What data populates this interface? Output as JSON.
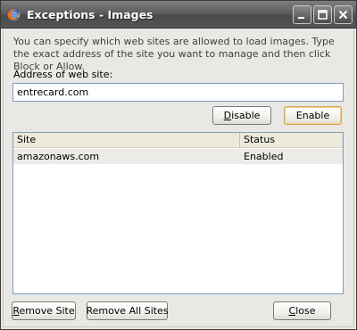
{
  "window": {
    "title": "Exceptions - Images"
  },
  "description": "You can specify which web sites are allowed to load images. Type the exact address of the site you want to manage and then click Block or Allow.",
  "address": {
    "label": "Address of web site:",
    "value": "entrecard.com"
  },
  "buttons": {
    "disable": "Disable",
    "enable": "Enable",
    "remove_site": "Remove Site",
    "remove_all_sites": "Remove All Sites",
    "close": "Close"
  },
  "table": {
    "columns": [
      "Site",
      "Status"
    ],
    "rows": [
      {
        "site": "amazonaws.com",
        "status": "Enabled"
      }
    ]
  },
  "icons": {
    "app": "firefox-icon",
    "minimize": "minimize-icon",
    "maximize": "maximize-icon",
    "close": "close-icon"
  },
  "colors": {
    "titlebar": "#555555",
    "dialog_bg": "#e9e8e4",
    "selected_row": "#ecebe8",
    "default_button_border": "#d2a35a"
  }
}
